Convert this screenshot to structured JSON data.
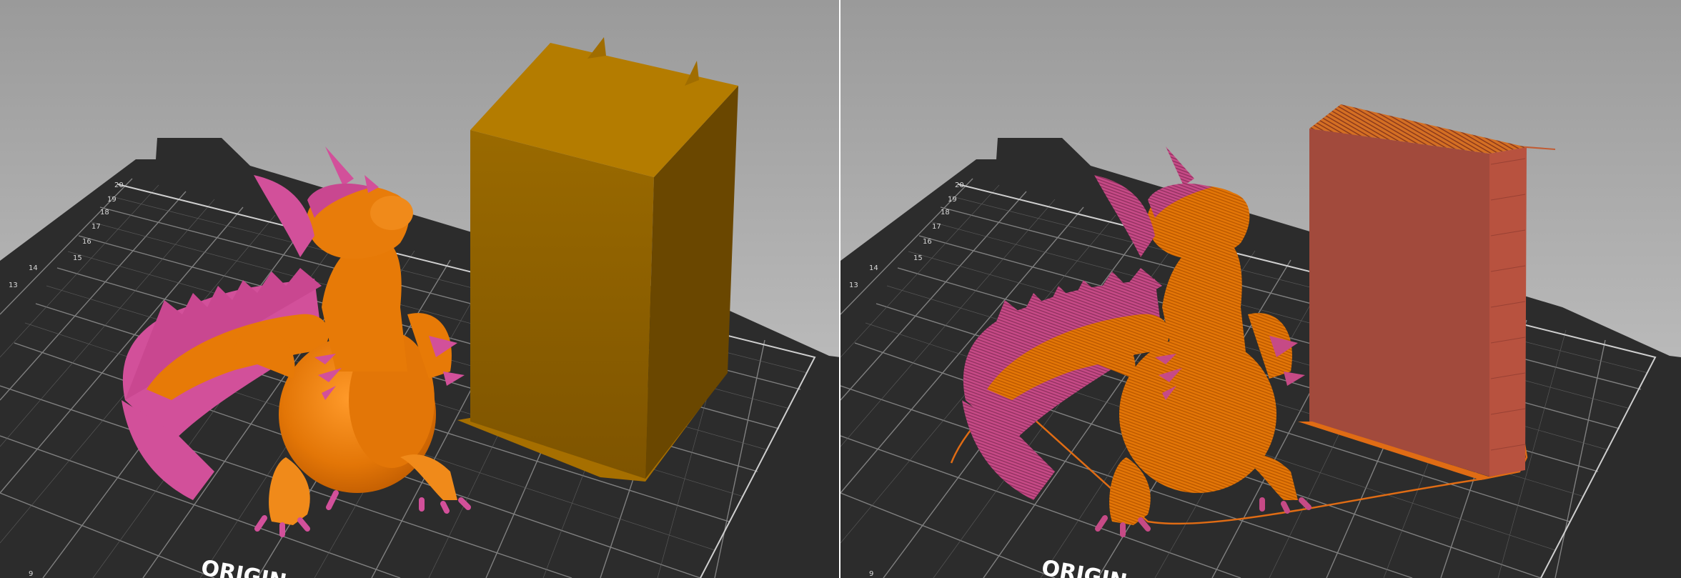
{
  "views": {
    "left": {
      "name": "model-preview",
      "bed_label": "ORIGIN",
      "axis_numbers": [
        "20",
        "19",
        "18",
        "17",
        "16",
        "15",
        "14",
        "13"
      ],
      "bottom_corner_number": "9",
      "colors": {
        "background_top": "#8f8f8f",
        "background_bottom": "#c8c8c8",
        "bed_plate": "#2c2c2c",
        "bed_grid": "#8a8a8a",
        "body": "#e77a07",
        "accent": "#d2509a",
        "block_front": "#8c5e00",
        "block_top": "#b47c00",
        "block_side": "#6a4700"
      }
    },
    "right": {
      "name": "sliced-preview",
      "bed_label": "ORIGIN",
      "axis_numbers": [
        "20",
        "19",
        "18",
        "17",
        "16",
        "15",
        "14",
        "13"
      ],
      "bottom_corner_number": "9",
      "colors": {
        "body": "#e37607",
        "accent": "#c64a86",
        "tower_front": "#a24a3c",
        "tower_top": "#d46f23",
        "tower_side": "#b8523f",
        "skirt": "#e06c14"
      }
    }
  }
}
